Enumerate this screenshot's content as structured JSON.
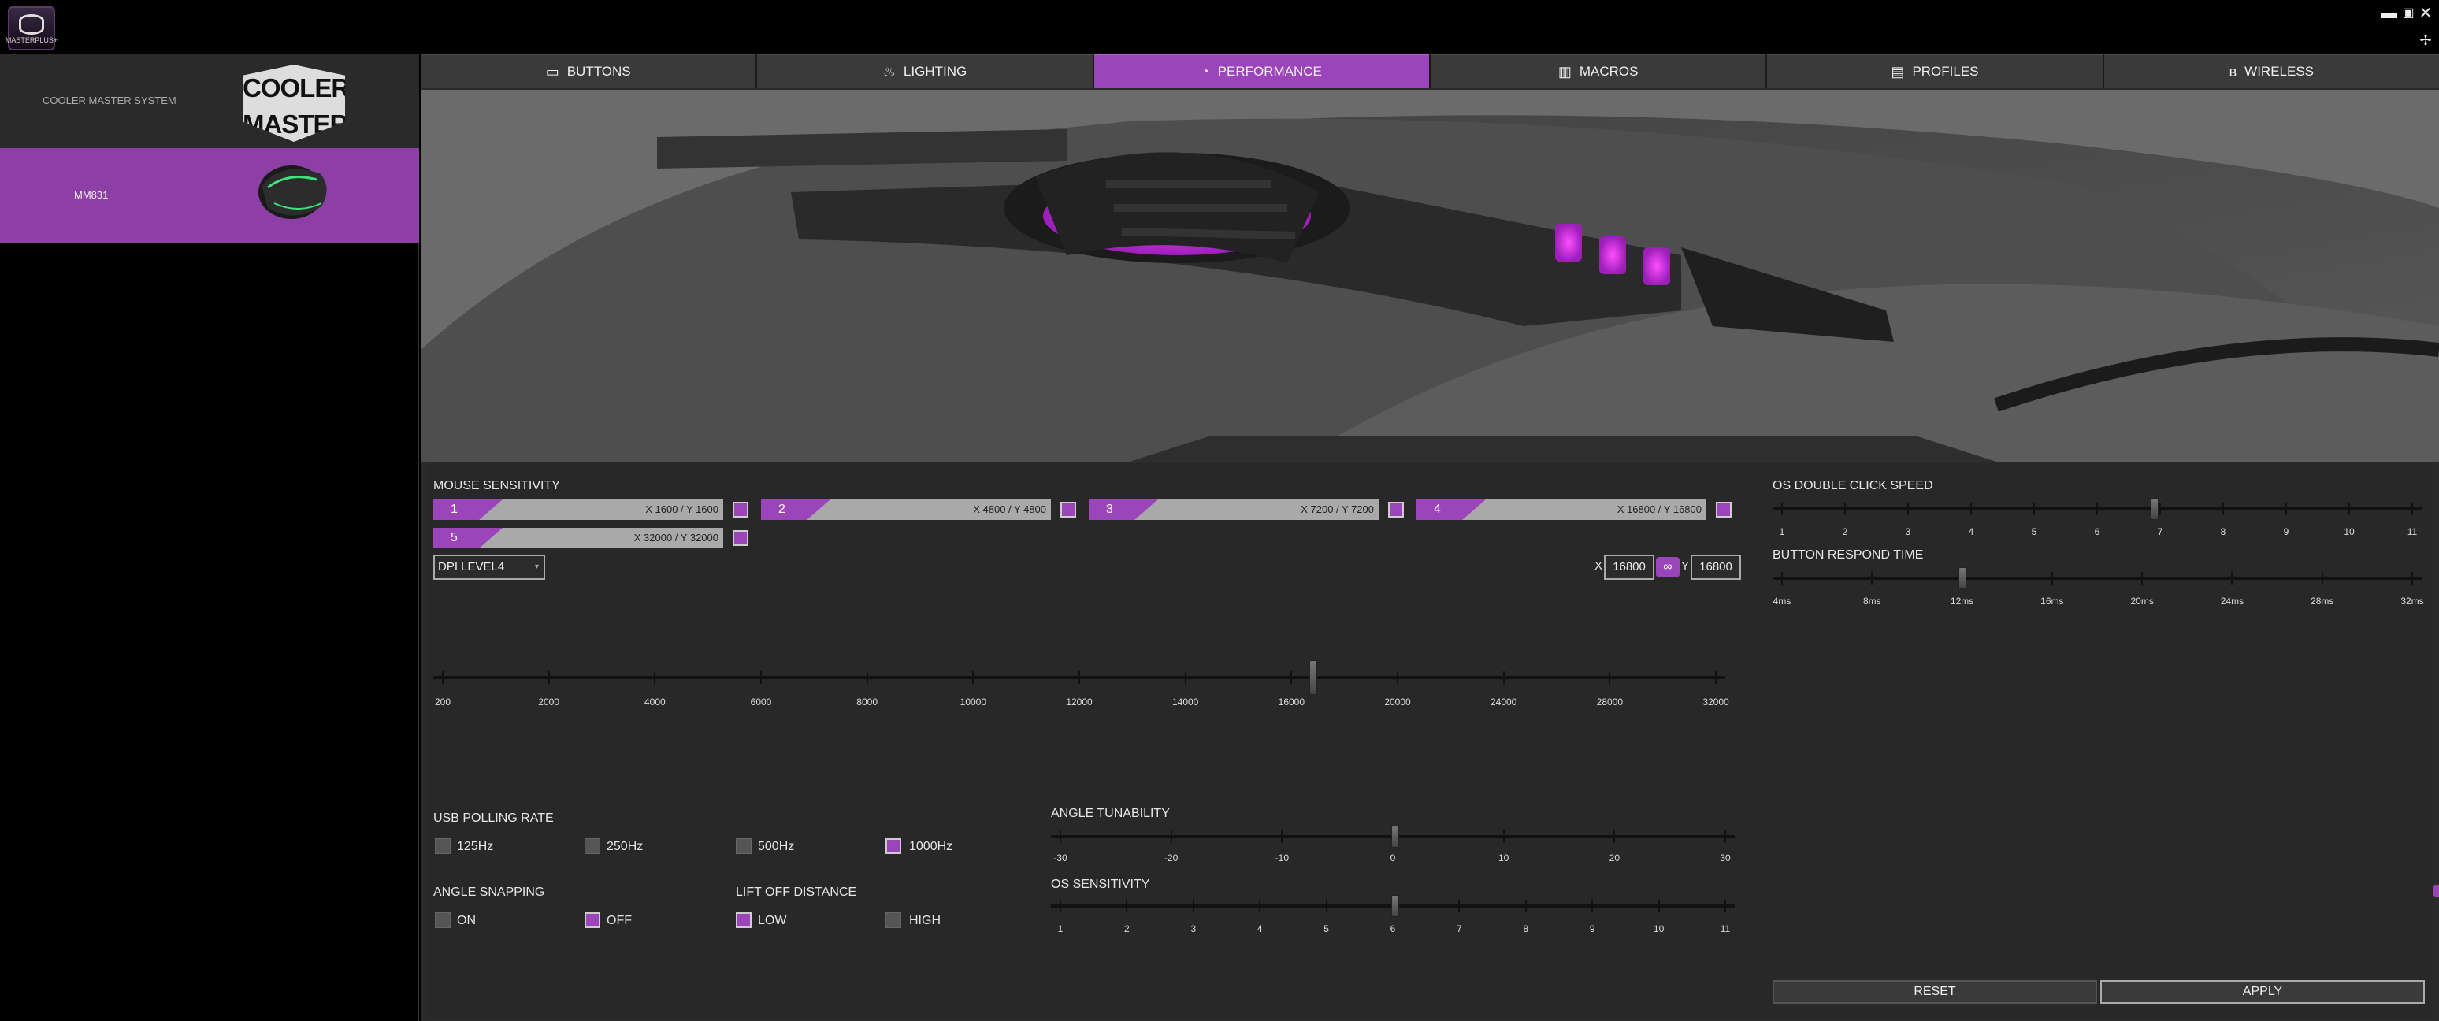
{
  "app": {
    "icon_label": "MASTERPLUS+",
    "minimize_icon": "minimize-icon",
    "maximize_icon": "maximize-icon",
    "close_icon": "close-icon",
    "pin_icon": "pin-icon"
  },
  "sidebar": {
    "system_label": "COOLER MASTER SYSTEM",
    "logo_text_1": "COOLER",
    "logo_text_2": "MASTER",
    "device_label": "MM831"
  },
  "tabs": [
    {
      "label": "BUTTONS",
      "icon": "mouse-icon",
      "active": false
    },
    {
      "label": "LIGHTING",
      "icon": "bulb-icon",
      "active": false
    },
    {
      "label": "PERFORMANCE",
      "icon": "gauge-icon",
      "active": true
    },
    {
      "label": "MACROS",
      "icon": "macro-icon",
      "active": false
    },
    {
      "label": "PROFILES",
      "icon": "profile-icon",
      "active": false
    },
    {
      "label": "WIRELESS",
      "icon": "bluetooth-icon",
      "active": false
    }
  ],
  "colors": {
    "accent": "#9c45ba",
    "panel": "#282828",
    "background": "#2a2a2a"
  },
  "sensitivity": {
    "title": "MOUSE SENSITIVITY",
    "levels": [
      {
        "num": "1",
        "value": "X 1600 / Y 1600"
      },
      {
        "num": "2",
        "value": "X 4800 / Y 4800"
      },
      {
        "num": "3",
        "value": "X 7200 / Y 7200"
      },
      {
        "num": "4",
        "value": "X 16800 / Y 16800"
      },
      {
        "num": "5",
        "value": "X 32000 / Y 32000"
      }
    ],
    "dpi_select": "DPI LEVEL4",
    "x_label": "X",
    "y_label": "Y",
    "x_value": "16800",
    "y_value": "16800",
    "link_icon": "link-icon",
    "scale": [
      "200",
      "2000",
      "4000",
      "6000",
      "8000",
      "10000",
      "12000",
      "14000",
      "16000",
      "20000",
      "24000",
      "28000",
      "32000"
    ],
    "slider_position": "16800"
  },
  "polling": {
    "title": "USB POLLING RATE",
    "options": [
      "125Hz",
      "250Hz",
      "500Hz",
      "1000Hz"
    ],
    "selected": "1000Hz"
  },
  "angle_snapping": {
    "title": "ANGLE SNAPPING",
    "options": [
      "ON",
      "OFF"
    ],
    "selected": "OFF"
  },
  "lift_off": {
    "title": "LIFT OFF DISTANCE",
    "options": [
      "LOW",
      "HIGH"
    ],
    "selected": "LOW"
  },
  "angle_tunability": {
    "title": "ANGLE TUNABILITY",
    "scale": [
      "-30",
      "-20",
      "-10",
      "0",
      "10",
      "20",
      "30"
    ],
    "value": "0"
  },
  "os_sensitivity": {
    "title": "OS SENSITIVITY",
    "scale": [
      "1",
      "2",
      "3",
      "4",
      "5",
      "6",
      "7",
      "8",
      "9",
      "10",
      "11"
    ],
    "value": "6"
  },
  "double_click": {
    "title": "OS DOUBLE CLICK SPEED",
    "scale": [
      "1",
      "2",
      "3",
      "4",
      "5",
      "6",
      "7",
      "8",
      "9",
      "10",
      "11"
    ],
    "value": "7"
  },
  "respond_time": {
    "title": "BUTTON RESPOND TIME",
    "scale": [
      "4ms",
      "8ms",
      "12ms",
      "16ms",
      "20ms",
      "24ms",
      "28ms",
      "32ms"
    ],
    "value": "12ms"
  },
  "actions": {
    "reset": "RESET",
    "apply": "APPLY"
  }
}
